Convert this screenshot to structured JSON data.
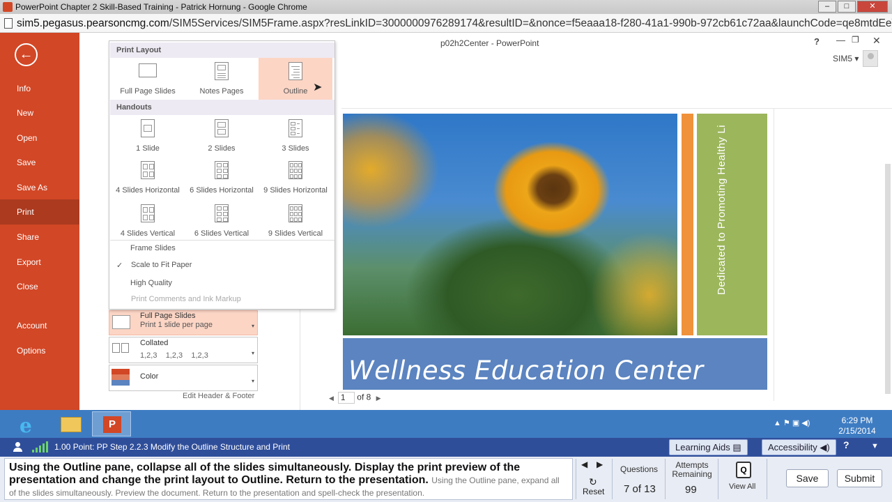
{
  "browser": {
    "title": "PowerPoint Chapter 2 Skill-Based Training - Patrick Hornung - Google Chrome",
    "url_domain": "sim5.pegasus.pearsoncmg.com",
    "url_path": "/SIM5Services/SIM5Frame.aspx?resLinkID=3000000976289174&resultID=&nonce=f5eaaa18-f280-41a1-990b-972cb61c72aa&launchCode=qe8mtdEeV5qruF3I",
    "minimize": "–",
    "maximize": "□",
    "close": "✕"
  },
  "app": {
    "doc_title": "p02h2Center - PowerPoint",
    "help": "?",
    "minimize": "—",
    "restore": "❐",
    "close": "✕",
    "user": "SIM5 ▾"
  },
  "backstage": {
    "back": "←",
    "items": [
      "Info",
      "New",
      "Open",
      "Save",
      "Save As",
      "Print",
      "Share",
      "Export",
      "Close",
      "Account",
      "Options"
    ],
    "selected": "Print"
  },
  "dropdown": {
    "print_layout_header": "Print Layout",
    "layouts": [
      "Full Page Slides",
      "Notes Pages",
      "Outline"
    ],
    "selected_layout": "Outline",
    "handouts_header": "Handouts",
    "handouts": [
      "1 Slide",
      "2 Slides",
      "3 Slides",
      "4 Slides Horizontal",
      "6 Slides Horizontal",
      "9 Slides Horizontal",
      "4 Slides Vertical",
      "6 Slides Vertical",
      "9 Slides Vertical"
    ],
    "menu": [
      "Frame Slides",
      "Scale to Fit Paper",
      "High Quality",
      "Print Comments and Ink Markup"
    ],
    "checked": "Scale to Fit Paper",
    "check_glyph": "✓"
  },
  "settings": {
    "layout_title": "Full Page Slides",
    "layout_sub": "Print 1 slide per page",
    "collate_title": "Collated",
    "collate_sub": "1,2,3    1,2,3    1,2,3",
    "color_title": "Color",
    "edit_header_footer": "Edit Header & Footer",
    "arrow": "▾"
  },
  "preview": {
    "slide_title": "Wellness Education Center",
    "vertical_text": "Dedicated to Promoting Healthy Li",
    "page_current": "1",
    "page_of": "of 8",
    "prev": "◀",
    "next": "▶"
  },
  "taskbar": {
    "tray_icons": "▲  ⚑  ▣  ◀)",
    "time": "6:29 PM",
    "date": "2/15/2014"
  },
  "sim": {
    "question_header": "1.00 Point: PP Step 2.2.3 Modify the Outline Structure and Print",
    "learning_aids": "Learning Aids",
    "accessibility": "Accessibility",
    "help": "?",
    "collapse": "▼",
    "instruction_bold": "Using the Outline pane, collapse all of the slides simultaneously. Display the print preview of the presentation and change the print layout to Outline. Return to the presentation.",
    "instruction_small": "Using the Outline pane, expand all of the slides simultaneously. Preview the document. Return to the presentation and spell-check the presentation.",
    "nav_prev": "◀",
    "nav_next": "▶",
    "reset_icon": "↻",
    "reset": "Reset",
    "questions_label": "Questions",
    "questions_value": "7 of 13",
    "attempts_label": "Attempts Remaining",
    "attempts_value": "99",
    "view_all": "View All",
    "view_all_icon": "Q",
    "save": "Save",
    "submit": "Submit"
  },
  "colors": {
    "backstage": "#d24726",
    "backstage_selected": "#ab3a1f",
    "selection": "#fcd5c5",
    "taskbar": "#3e7cc2",
    "sim_bar": "#2f4e9a",
    "slide_banner": "#5b84c0",
    "slide_green": "#9cb65c",
    "slide_orange": "#f0913b"
  }
}
